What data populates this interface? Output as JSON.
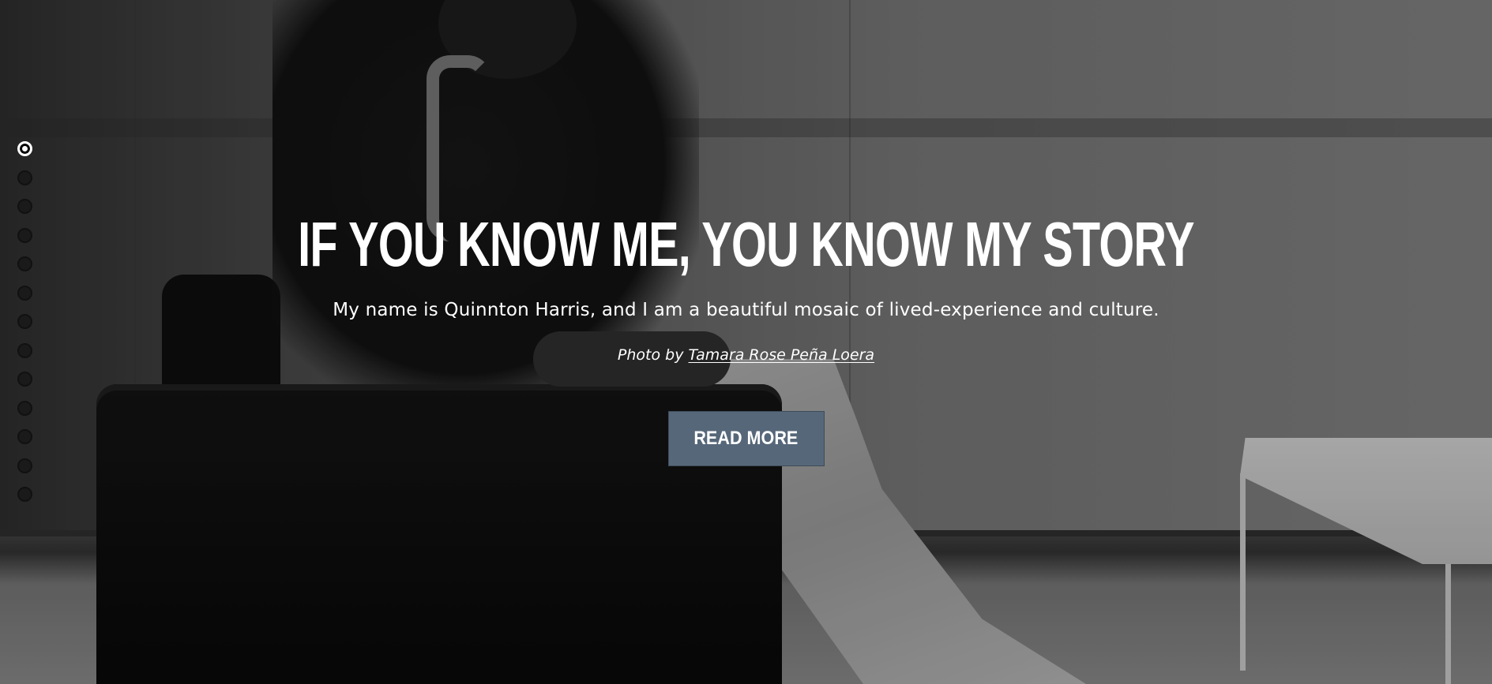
{
  "hero": {
    "headline": "IF YOU KNOW ME, YOU KNOW MY STORY",
    "subtitle": "My name is Quinnton Harris, and I am a beautiful mosaic of lived-experience and culture.",
    "credit_prefix": "Photo by",
    "credit_name": "Tamara Rose Peña Loera",
    "cta_label": "READ MORE"
  },
  "pager": {
    "count": 13,
    "active_index": 0
  },
  "colors": {
    "cta_background": "#566779",
    "text": "#ffffff"
  }
}
